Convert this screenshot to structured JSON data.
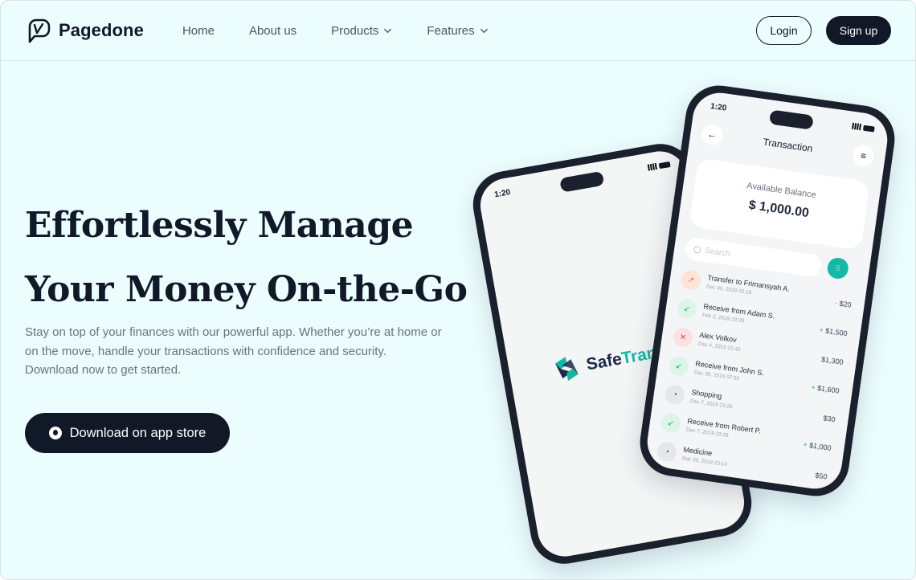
{
  "nav": {
    "logo_text": "Pagedone",
    "menu": [
      {
        "label": "Home",
        "has_dropdown": false
      },
      {
        "label": "About us",
        "has_dropdown": false
      },
      {
        "label": "Products",
        "has_dropdown": true
      },
      {
        "label": "Features",
        "has_dropdown": true
      }
    ],
    "login_label": "Login",
    "signup_label": "Sign up"
  },
  "hero": {
    "headline_line1": "Effortlessly Manage",
    "headline_line2": "Your Money On-the-Go",
    "subtitle": "Stay on top of your finances with our powerful app. Whether you’re at home or on the move, handle your transactions with confidence and security. Download now to get started.",
    "download_label": "Download on app store"
  },
  "phone_left": {
    "time": "1:20",
    "brand_part1": "Safe",
    "brand_part2": "Transa"
  },
  "phone_right": {
    "time": "1:20",
    "title": "Transaction",
    "balance_label": "Available Balance",
    "balance_value": "$ 1,000.00",
    "search_placeholder": "Search",
    "transactions": [
      {
        "name": "Transfer to Frimansyah A.",
        "date": "Dec 30, 2019 05:18",
        "sign": "-",
        "amount": "$20",
        "icon": "arrow-up-right-icon",
        "kind": "out"
      },
      {
        "name": "Receive from Adam S.",
        "date": "Feb 2, 2019 19:28",
        "sign": "+",
        "amount": "$1,500",
        "icon": "arrow-down-left-icon",
        "kind": "in"
      },
      {
        "name": "Alex Volkov",
        "date": "Dec 4, 2019 21:42",
        "sign": "",
        "amount": "$1,300",
        "icon": "x-icon",
        "kind": "fail"
      },
      {
        "name": "Receive from John S.",
        "date": "Dec 30, 2019 07:52",
        "sign": "+",
        "amount": "$1,600",
        "icon": "arrow-down-left-icon",
        "kind": "in"
      },
      {
        "name": "Shopping",
        "date": "Dec 7, 2019 23:26",
        "sign": "",
        "amount": "$30",
        "icon": "clock-icon",
        "kind": "neu"
      },
      {
        "name": "Receive from Robert P.",
        "date": "Dec 7, 2019 23:26",
        "sign": "+",
        "amount": "$1,000",
        "icon": "arrow-down-left-icon",
        "kind": "in"
      },
      {
        "name": "Medicine",
        "date": "Mar 20, 2019 23:14",
        "sign": "",
        "amount": "$50",
        "icon": "clock-icon",
        "kind": "neu"
      }
    ]
  },
  "colors": {
    "background": "#ecfdfe",
    "primary_dark": "#111827",
    "accent_teal": "#14b8a6",
    "text_muted": "#6b7280"
  }
}
